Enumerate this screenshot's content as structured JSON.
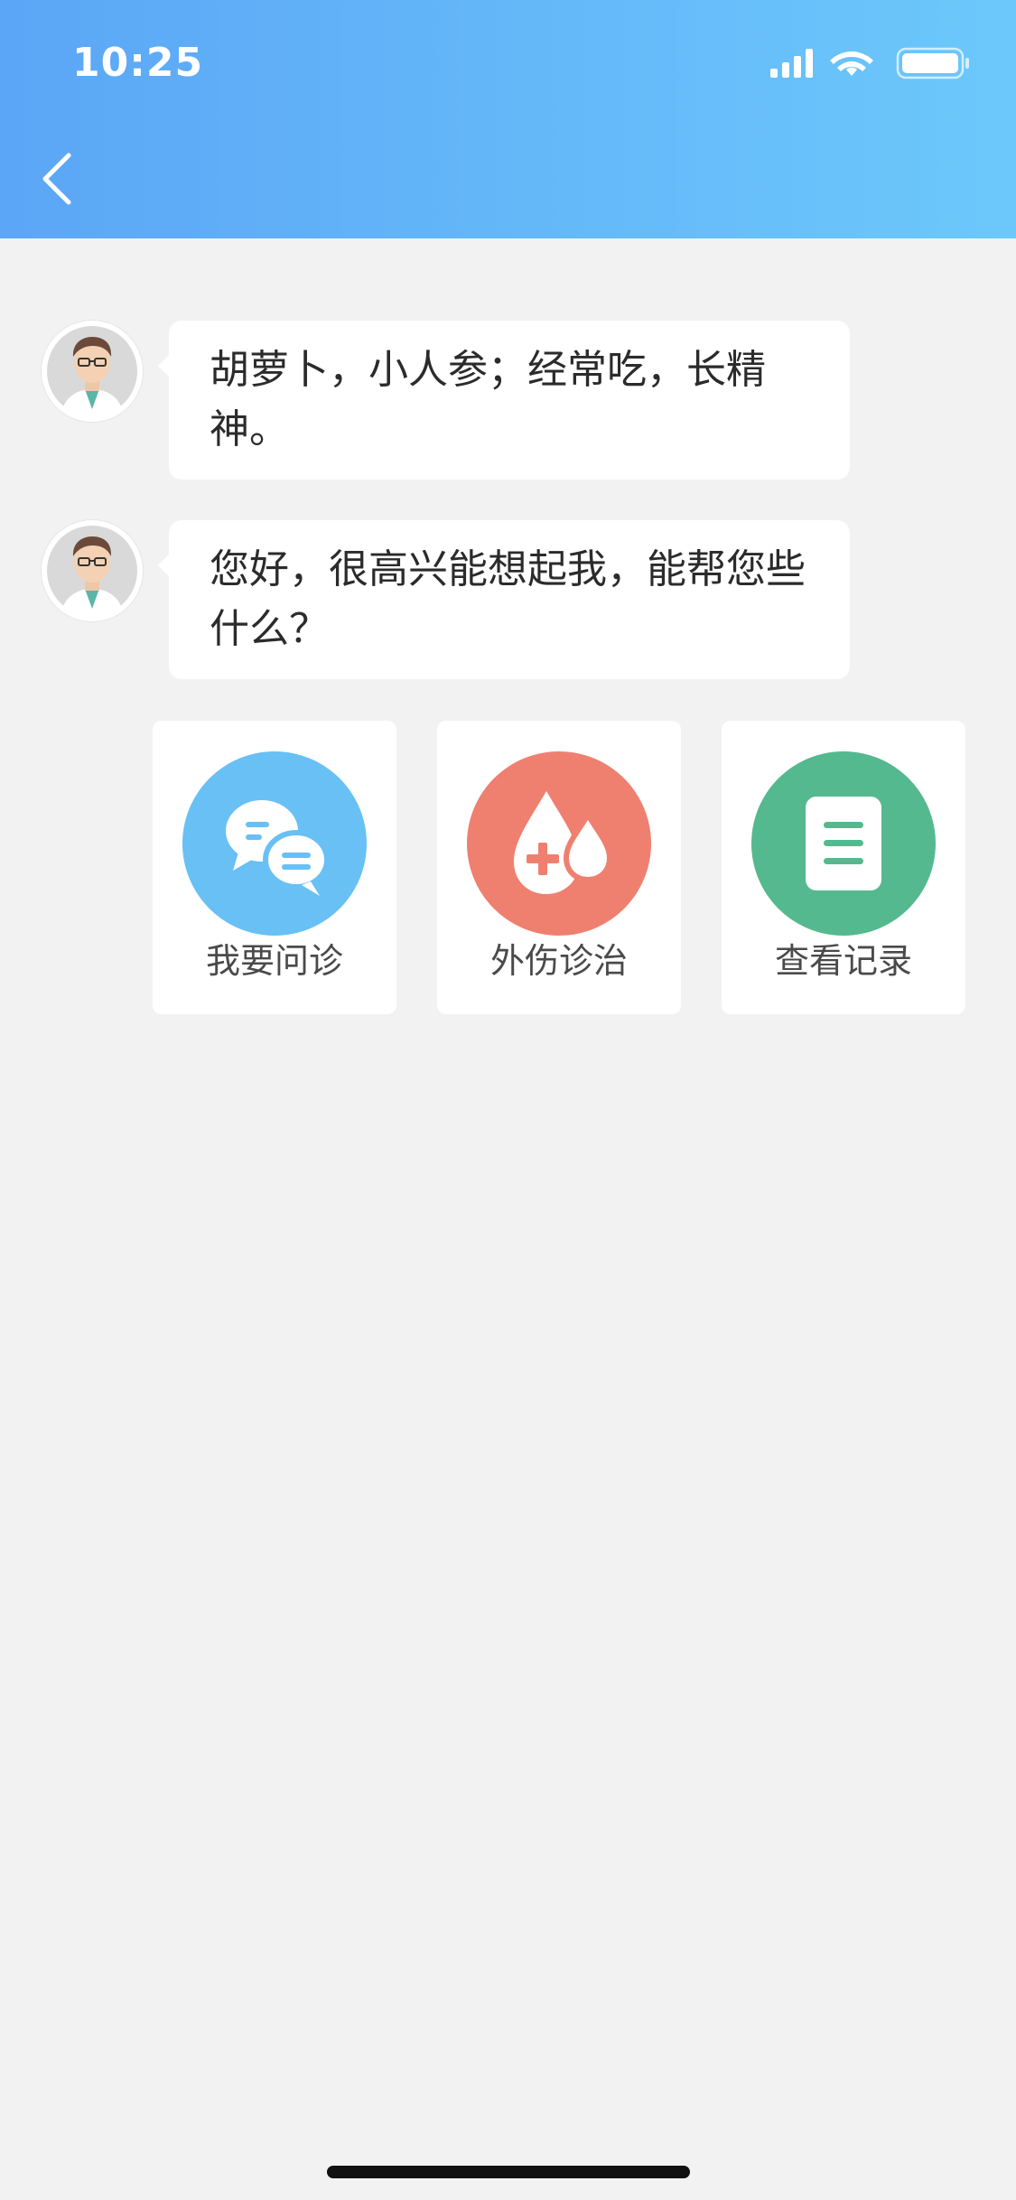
{
  "status_bar": {
    "time": "10:25"
  },
  "header": {
    "back_icon": "chevron-left-icon"
  },
  "messages": [
    {
      "text": "胡萝卜，小人参；经常吃，长精神。",
      "avatar": "doctor-avatar"
    },
    {
      "text": "您好，很高兴能想起我，能帮您些什么？",
      "avatar": "doctor-avatar"
    }
  ],
  "actions": [
    {
      "label": "我要问诊",
      "icon": "chat-bubbles-icon",
      "color": "#68c0f4"
    },
    {
      "label": "外伤诊治",
      "icon": "blood-drop-plus-icon",
      "color": "#ef8070"
    },
    {
      "label": "查看记录",
      "icon": "document-icon",
      "color": "#54b98e"
    }
  ]
}
